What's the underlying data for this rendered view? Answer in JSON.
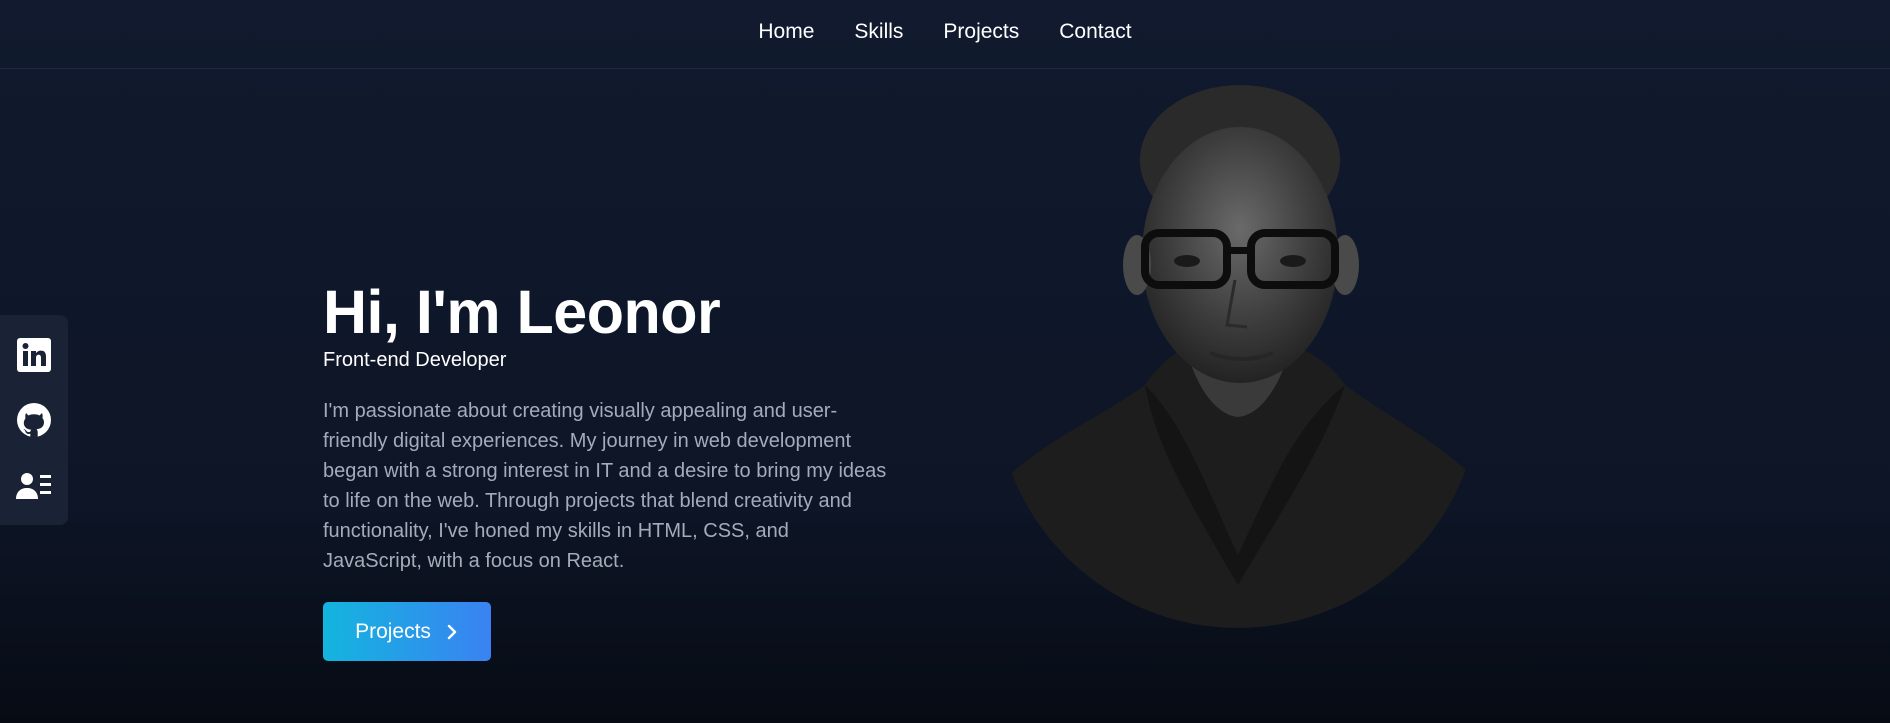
{
  "nav": {
    "items": [
      {
        "label": "Home"
      },
      {
        "label": "Skills"
      },
      {
        "label": "Projects"
      },
      {
        "label": "Contact"
      }
    ]
  },
  "social": {
    "icons": [
      "linkedin-icon",
      "github-icon",
      "resume-icon"
    ]
  },
  "hero": {
    "title": "Hi, I'm Leonor",
    "subtitle": "Front-end Developer",
    "description": "I'm passionate about creating visually appealing and user-friendly digital experiences. My journey in web development began with a strong interest in IT and a desire to bring my ideas to life on the web. Through projects that blend creativity and functionality, I've honed my skills in HTML, CSS, and JavaScript, with a focus on React.",
    "cta_label": "Projects",
    "portrait_icon": "portrait-photo"
  },
  "colors": {
    "background": "#111a2e",
    "accent_start": "#13b5de",
    "accent_end": "#3a82f2",
    "muted_text": "#a4acbb"
  }
}
